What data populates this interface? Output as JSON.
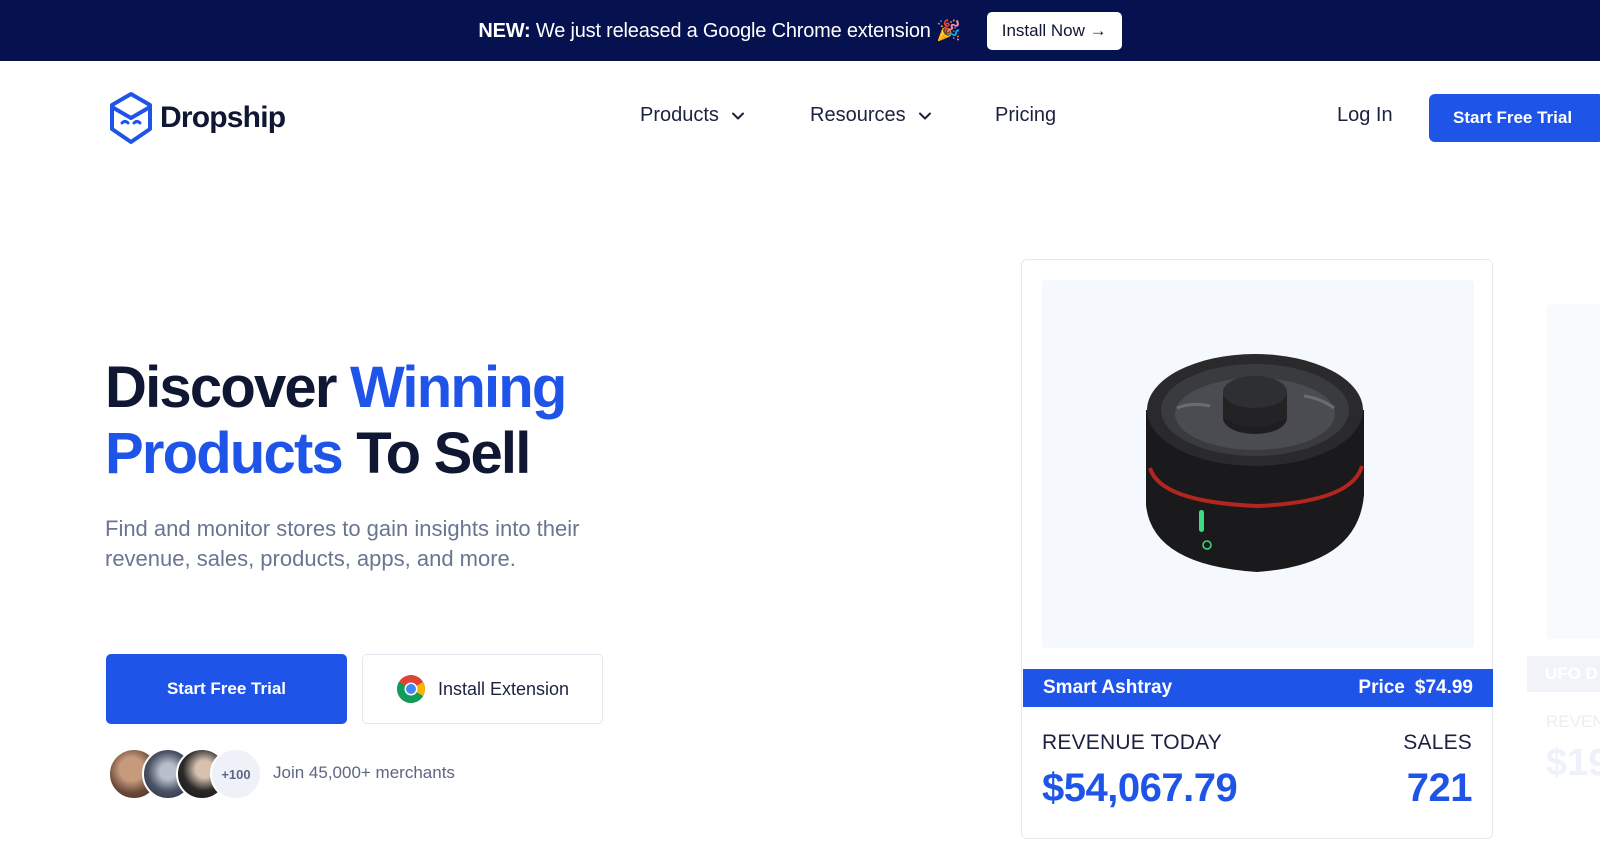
{
  "announcement": {
    "prefix": "NEW:",
    "text": "We just released a Google Chrome extension",
    "emoji": "🎉",
    "button_label": "Install Now →"
  },
  "nav": {
    "brand": "Dropship",
    "links": [
      {
        "label": "Products",
        "has_dropdown": true
      },
      {
        "label": "Resources",
        "has_dropdown": true
      },
      {
        "label": "Pricing",
        "has_dropdown": false
      }
    ],
    "login_label": "Log In",
    "cta_label": "Start Free Trial"
  },
  "hero": {
    "title_part1": "Discover ",
    "title_part2": "Winning",
    "title_part3": "Products",
    "title_part4": " To Sell",
    "subtitle": "Find and monitor stores to gain insights into their revenue, sales, products, apps, and more.",
    "primary_button": "Start Free Trial",
    "secondary_button": "Install Extension",
    "avatar_more": "+100",
    "merchants_text": "Join 45,000+ merchants"
  },
  "product_card": {
    "name": "Smart Ashtray",
    "price_label": "Price",
    "price": "$74.99",
    "revenue_label": "REVENUE TODAY",
    "revenue_value": "$54,067.79",
    "sales_label": "SALES",
    "sales_value": "721"
  },
  "ghost_card": {
    "name": "UFO D",
    "revenue_label": "REVEN",
    "revenue_value": "$19"
  },
  "colors": {
    "brand_blue": "#1f54e8",
    "navy": "#06114f",
    "text_dark": "#0f1733",
    "text_muted": "#6a7591"
  }
}
